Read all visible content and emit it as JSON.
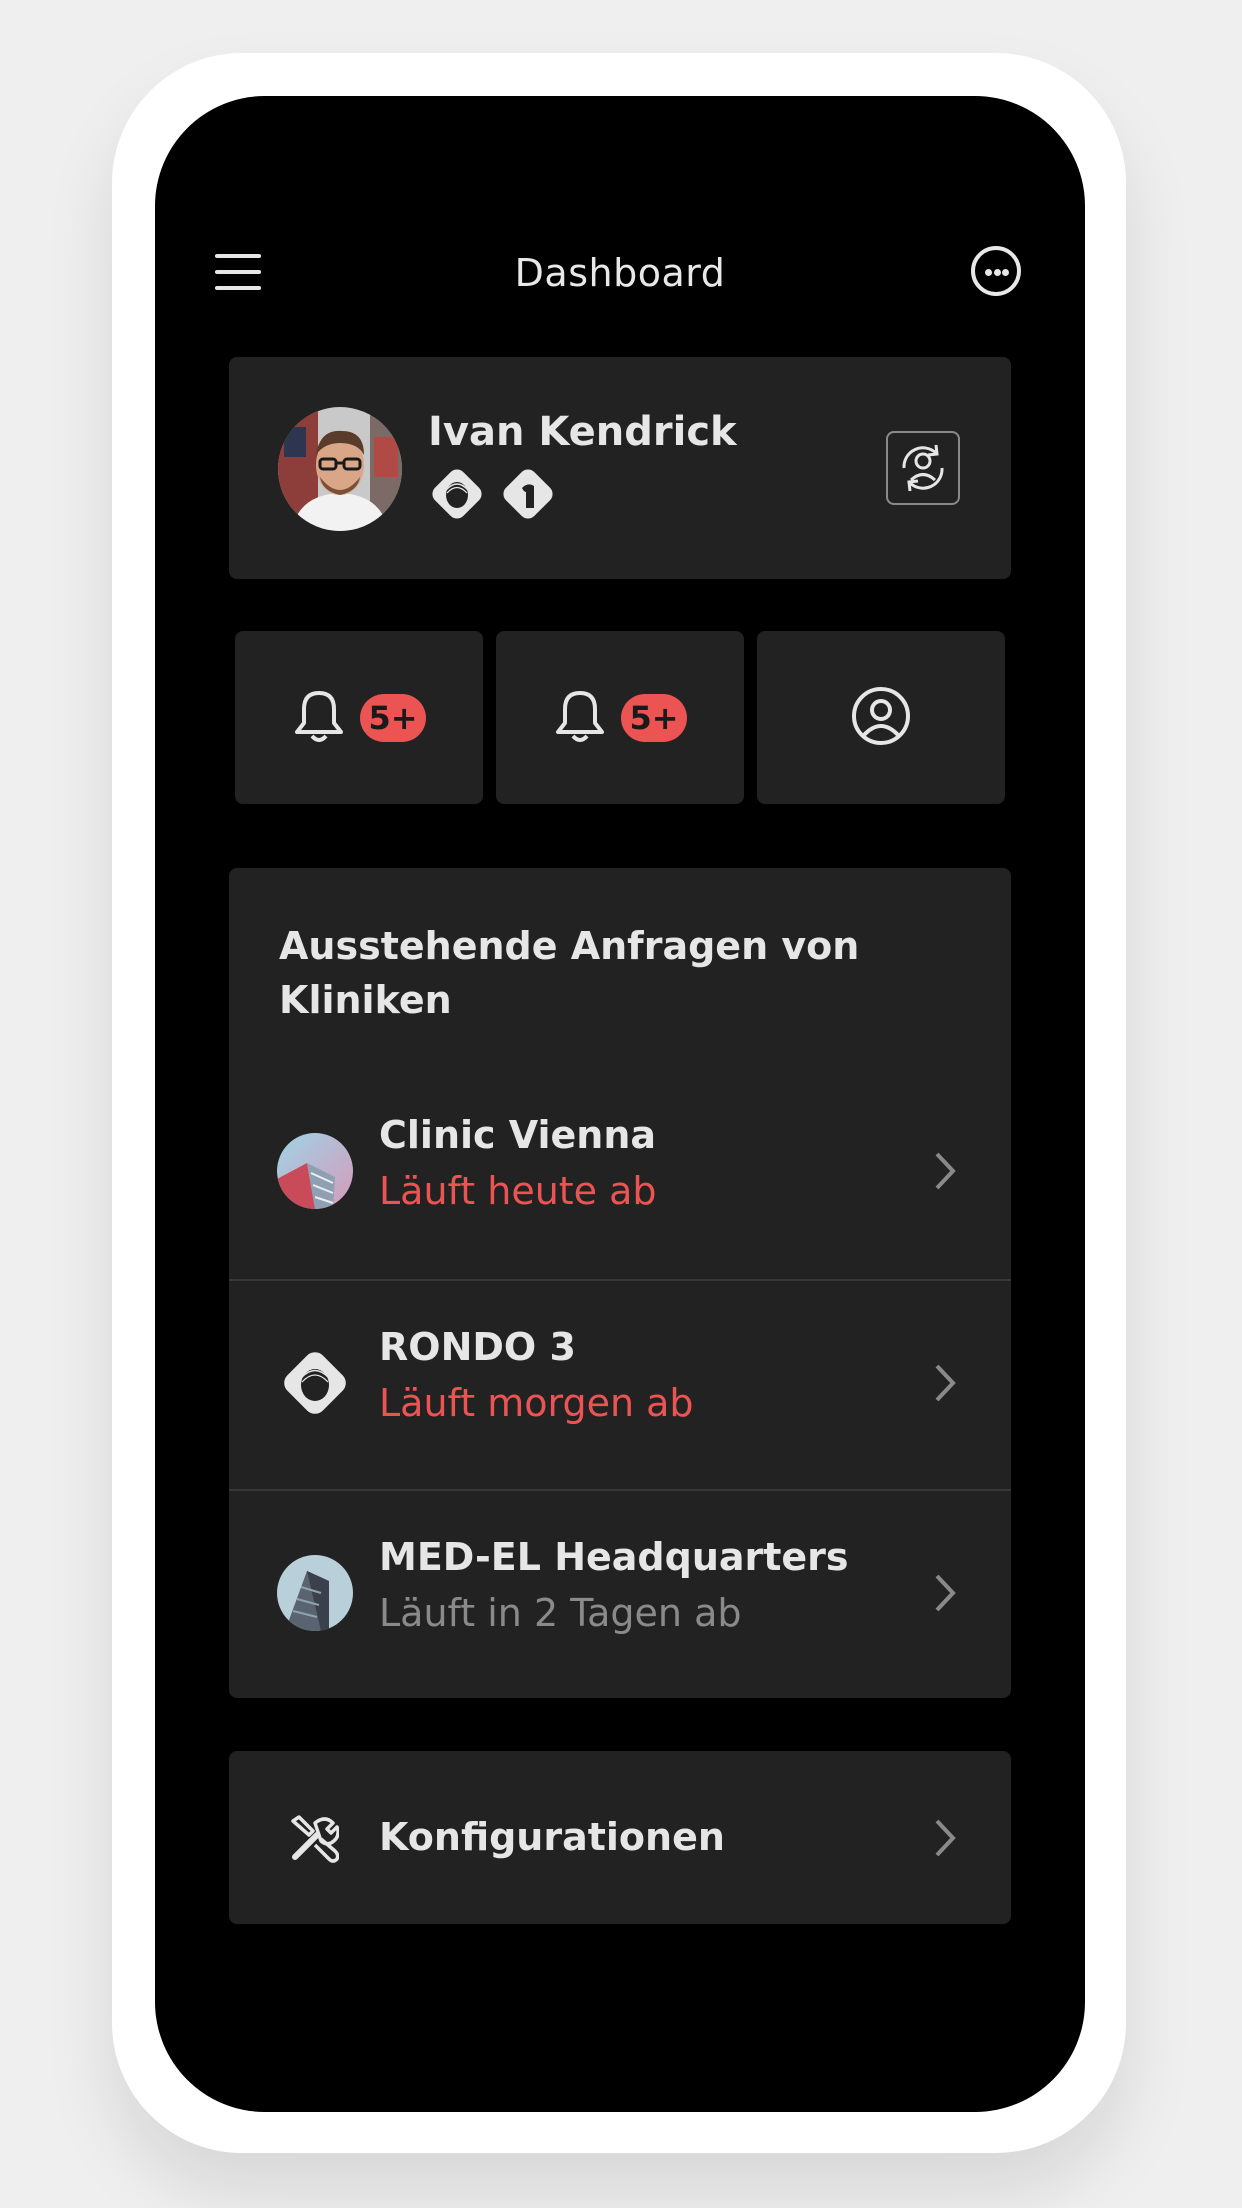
{
  "header": {
    "title": "Dashboard",
    "menu_icon": "hamburger-menu-icon",
    "more_icon": "more-options-icon"
  },
  "profile": {
    "name": "Ivan Kendrick",
    "badges": [
      "rondo-device-icon",
      "implant-device-icon"
    ],
    "switch_icon": "switch-user-icon"
  },
  "quick_tiles": [
    {
      "icon": "bell-icon",
      "count": "5+"
    },
    {
      "icon": "bell-icon",
      "count": "5+"
    },
    {
      "icon": "user-circle-icon"
    }
  ],
  "requests": {
    "title": "Ausstehende Anfragen von Kliniken",
    "items": [
      {
        "name": "Clinic Vienna",
        "status": "Läuft heute ab",
        "status_color": "#ec5454"
      },
      {
        "name": "RONDO 3",
        "status": "Läuft morgen ab",
        "status_color": "#ec5454"
      },
      {
        "name": "MED-EL Headquarters",
        "status": "Läuft in 2 Tagen ab",
        "status_color": "#8a8a8a"
      }
    ]
  },
  "configurations": {
    "label": "Konfigurationen",
    "icon": "tools-icon"
  },
  "colors": {
    "accent_red": "#ec5454",
    "card_bg": "#222222",
    "screen_bg": "#000000"
  }
}
